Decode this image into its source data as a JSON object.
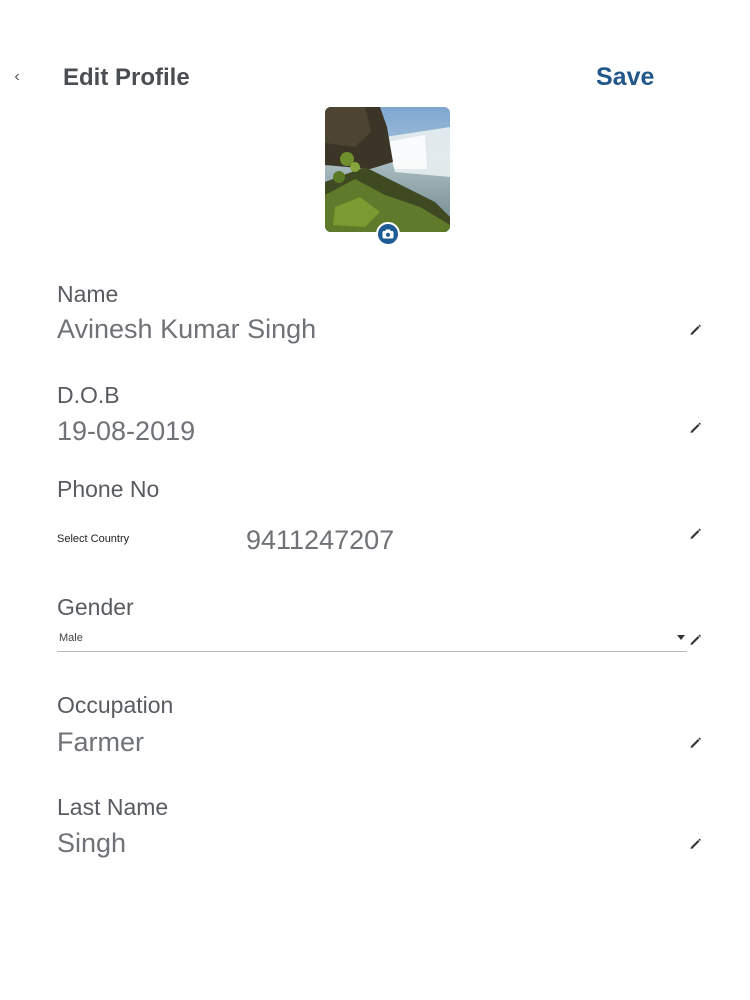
{
  "header": {
    "back_icon": "chevron-left-icon",
    "title": "Edit Profile",
    "save_label": "Save",
    "save_color": "#22578a"
  },
  "avatar": {
    "description_icon": "camera-icon",
    "accent": "#1f5c96"
  },
  "fields": {
    "name": {
      "label": "Name",
      "value": "Avinesh Kumar Singh"
    },
    "dob": {
      "label": "D.O.B",
      "value": "19-08-2019"
    },
    "phone": {
      "label": "Phone No",
      "country_placeholder": "Select Country",
      "value": "9411247207"
    },
    "gender": {
      "label": "Gender",
      "value": "Male"
    },
    "occupation": {
      "label": "Occupation",
      "value": "Farmer"
    },
    "last_name": {
      "label": "Last Name",
      "value": "Singh"
    }
  },
  "icons": {
    "edit": "pencil-icon",
    "dropdown": "chevron-down-icon"
  }
}
